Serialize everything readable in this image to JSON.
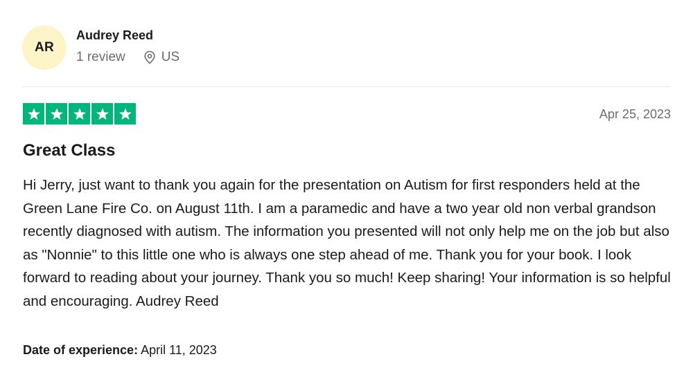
{
  "reviewer": {
    "initials": "AR",
    "name": "Audrey Reed",
    "review_count": "1 review",
    "location": "US"
  },
  "review": {
    "rating": 5,
    "rating_max": 5,
    "star_color": "#00b67a",
    "date": "Apr 25, 2023",
    "title": "Great Class",
    "text": "Hi Jerry, just want to thank you again for the presentation on Autism for first responders held at the Green Lane Fire Co. on August 11th. I am a paramedic and have a two year old non verbal grandson recently diagnosed with autism. The information you presented will not only help me on the job but also as \"Nonnie\" to this little one who is always one step ahead of me. Thank you for your book. I look forward to reading about your journey. Thank you so much! Keep sharing! Your information is so helpful and encouraging. Audrey Reed",
    "experience_label": "Date of experience:",
    "experience_date": "April 11, 2023"
  },
  "icons": {
    "location": "location-pin-icon",
    "star": "star-icon"
  }
}
